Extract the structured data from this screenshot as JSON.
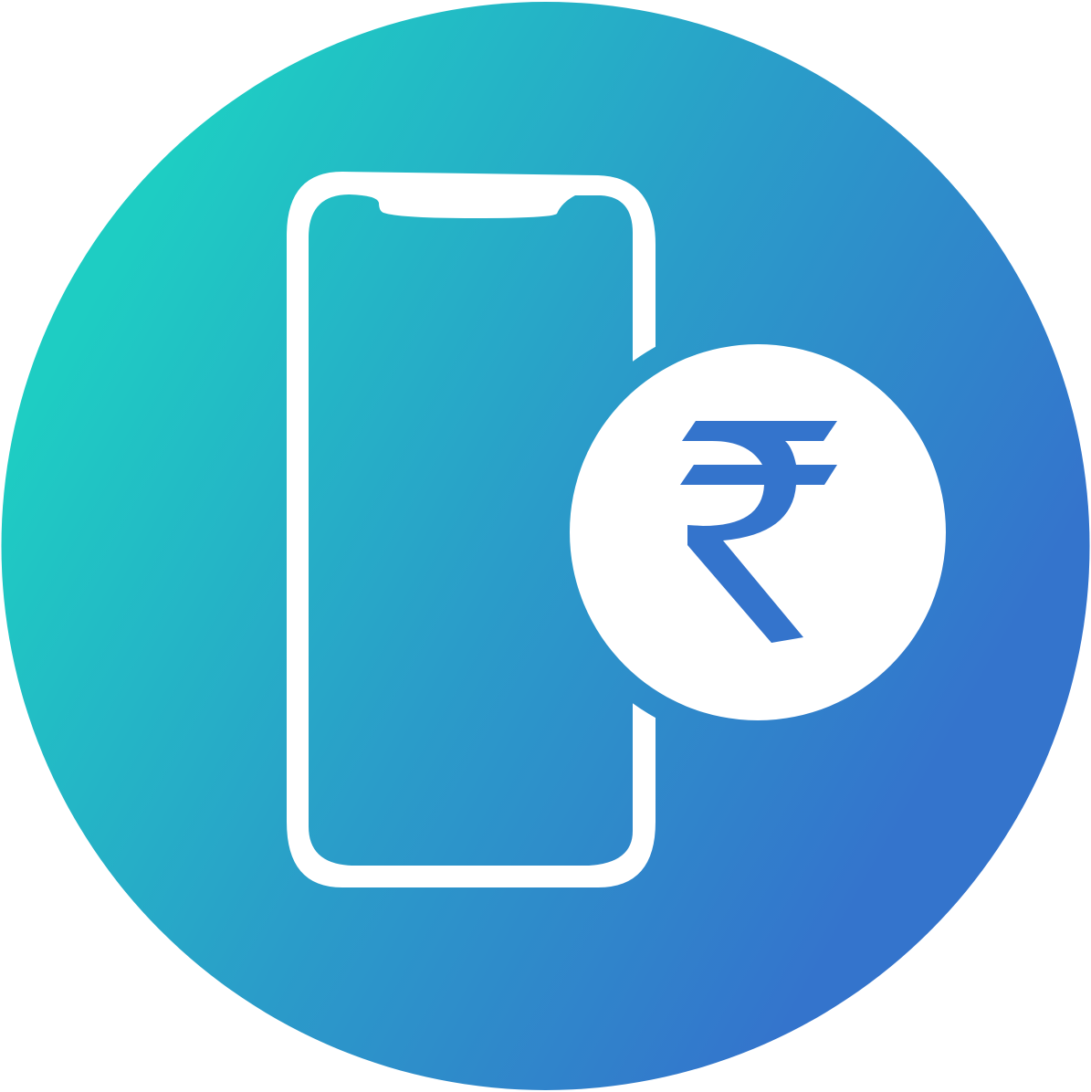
{
  "icon": {
    "name": "mobile-payment-rupee-icon",
    "parts": [
      "gradient-circle-background",
      "smartphone-outline-icon",
      "rupee-coin-icon"
    ]
  },
  "colors": {
    "gradient_start": "#1ecdc3",
    "gradient_mid": "#2a9dc9",
    "gradient_end": "#3474cc",
    "foreground": "#ffffff"
  }
}
